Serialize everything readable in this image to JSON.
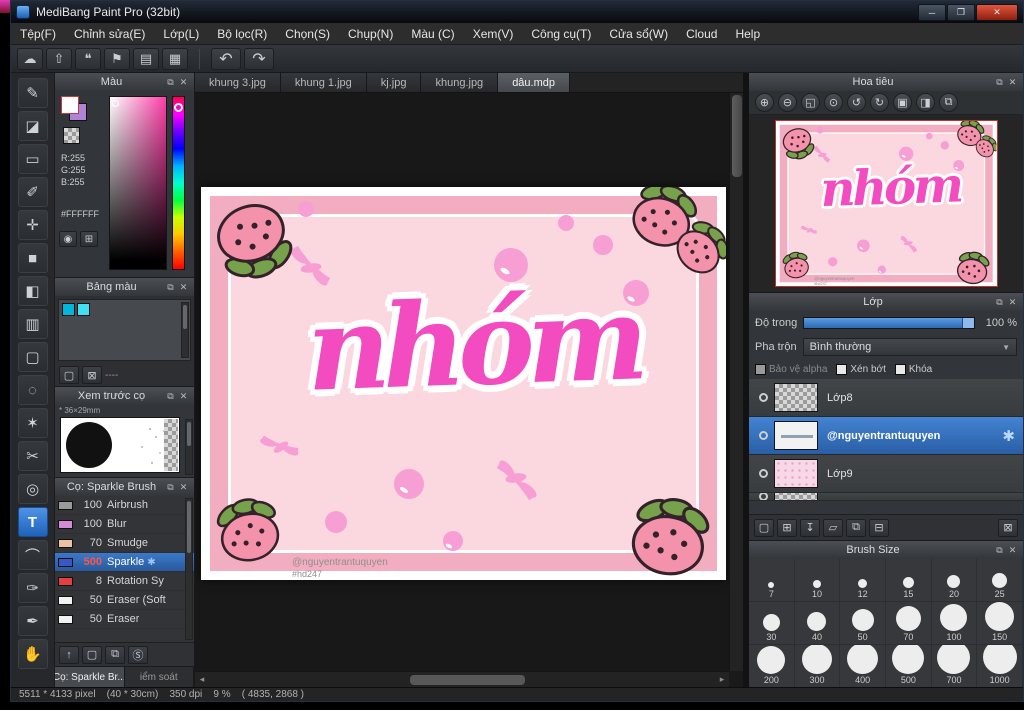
{
  "window": {
    "title": "MediBang Paint Pro (32bit)",
    "controls": {
      "minimize": "─",
      "maximize": "❐",
      "close": "✕"
    }
  },
  "menu": {
    "items": [
      "Tệp(F)",
      "Chỉnh sửa(E)",
      "Lớp(L)",
      "Bộ lọc(R)",
      "Chọn(S)",
      "Chụp(N)",
      "Màu (C)",
      "Xem(V)",
      "Công cụ(T)",
      "Cửa sổ(W)",
      "Cloud",
      "Help"
    ]
  },
  "toolbar": {
    "buttons": [
      {
        "name": "cloud",
        "glyph": "☁"
      },
      {
        "name": "upload",
        "glyph": "⇧"
      },
      {
        "name": "comment",
        "glyph": "❝"
      },
      {
        "name": "material",
        "glyph": "⚑"
      },
      {
        "name": "document",
        "glyph": "▤"
      },
      {
        "name": "layout-grid",
        "glyph": "▦"
      },
      {
        "name": "undo",
        "glyph": "↶"
      },
      {
        "name": "redo",
        "glyph": "↷"
      }
    ]
  },
  "tools": [
    {
      "name": "brush",
      "glyph": "✎"
    },
    {
      "name": "eraser",
      "glyph": "◪"
    },
    {
      "name": "rect-select",
      "glyph": "▭"
    },
    {
      "name": "marker",
      "glyph": "✐"
    },
    {
      "name": "move",
      "glyph": "✛"
    },
    {
      "name": "shape-fill",
      "glyph": "■"
    },
    {
      "name": "bucket",
      "glyph": "◧"
    },
    {
      "name": "gradient",
      "glyph": "▥"
    },
    {
      "name": "marquee",
      "glyph": "▢"
    },
    {
      "name": "ellipse-select",
      "glyph": "◌"
    },
    {
      "name": "magic-wand",
      "glyph": "✶"
    },
    {
      "name": "scissors",
      "glyph": "✂"
    },
    {
      "name": "divide",
      "glyph": "◎"
    },
    {
      "name": "text",
      "glyph": "T",
      "selected": true
    },
    {
      "name": "curve",
      "glyph": "⌒"
    },
    {
      "name": "eyedropper",
      "glyph": "✑"
    },
    {
      "name": "pen",
      "glyph": "✒"
    },
    {
      "name": "hand",
      "glyph": "✋"
    }
  ],
  "color_panel": {
    "title": "Màu",
    "r": "R:255",
    "g": "G:255",
    "b": "B:255",
    "hex": "#FFFFFF"
  },
  "palette_panel": {
    "title": "Bảng màu",
    "swatch1": "#00b6d9",
    "swatch2": "#41dff2",
    "dashes": "----"
  },
  "preview_panel": {
    "title": "Xem trước cọ",
    "size_label": "* 36×29mm"
  },
  "brush_panel": {
    "title": "Cọ: Sparkle Brush",
    "sparkle_icon": "✱",
    "brushes": [
      {
        "size": "100",
        "name": "Airbrush",
        "chip": "#9a9a9a"
      },
      {
        "size": "100",
        "name": "Blur",
        "chip": "#d58ad5"
      },
      {
        "size": "70",
        "name": "Smudge",
        "chip": "#eac3a4"
      },
      {
        "size": "500",
        "name": "Sparkle",
        "chip": "#3a57c8",
        "selected": true
      },
      {
        "size": "8",
        "name": "Rotation Sy",
        "chip": "#e04040"
      },
      {
        "size": "50",
        "name": "Eraser (Soft",
        "chip": "#f2f2f2"
      },
      {
        "size": "50",
        "name": "Eraser",
        "chip": "#f2f2f2"
      }
    ]
  },
  "brush_footer": {
    "buttons": [
      {
        "name": "upload-brush",
        "glyph": "↑"
      },
      {
        "name": "new-brush",
        "glyph": "▢"
      },
      {
        "name": "duplicate-brush",
        "glyph": "⧉"
      },
      {
        "name": "brush-script",
        "glyph": "Ⓢ"
      }
    ]
  },
  "bottom_tabs": [
    {
      "label": "Cọ: Sparkle Br..."
    },
    {
      "label": "iểm soát"
    }
  ],
  "doc_tabs": [
    {
      "label": "khung 3.jpg"
    },
    {
      "label": "khung 1.jpg"
    },
    {
      "label": "kj.jpg"
    },
    {
      "label": "khung.jpg"
    },
    {
      "label": "dâu.mdp",
      "active": true
    }
  ],
  "canvas": {
    "word": "nhóm",
    "credit1": "@nguyentrantuquyen",
    "credit2": "#hd247"
  },
  "navigator": {
    "title": "Hoa tiêu",
    "buttons": [
      {
        "name": "zoom-in",
        "glyph": "⊕"
      },
      {
        "name": "zoom-out",
        "glyph": "⊖"
      },
      {
        "name": "zoom-fit",
        "glyph": "◱"
      },
      {
        "name": "zoom-100",
        "glyph": "⊙"
      },
      {
        "name": "rotate-ccw",
        "glyph": "↺"
      },
      {
        "name": "rotate-cw",
        "glyph": "↻"
      },
      {
        "name": "select-area",
        "glyph": "▣"
      },
      {
        "name": "flip",
        "glyph": "◨"
      },
      {
        "name": "copy-view",
        "glyph": "⧉"
      }
    ]
  },
  "layer_panel": {
    "title": "Lớp",
    "opacity_label": "Độ trong",
    "opacity_value": "100 %",
    "blend_label": "Pha trộn",
    "blend_value": "Bình thường",
    "checkbox1": "Bảo vệ alpha",
    "checkbox2": "Xén bớt",
    "checkbox3": "Khóa",
    "layers": [
      {
        "name": "Lớp8"
      },
      {
        "name": "@nguyentrantuquyen",
        "selected": true,
        "badge": "✱"
      },
      {
        "name": "Lớp9"
      }
    ],
    "buttons": [
      {
        "name": "new-layer",
        "glyph": "▢"
      },
      {
        "name": "add-layer",
        "glyph": "⊞"
      },
      {
        "name": "layer-down",
        "glyph": "↧"
      },
      {
        "name": "new-folder",
        "glyph": "▱"
      },
      {
        "name": "duplicate-layer",
        "glyph": "⧉"
      },
      {
        "name": "merge-layer",
        "glyph": "⊟"
      },
      {
        "name": "delete-layer",
        "glyph": "⊠"
      }
    ]
  },
  "brush_size_panel": {
    "title": "Brush Size",
    "sizes": [
      "7",
      "10",
      "12",
      "15",
      "20",
      "25",
      "30",
      "40",
      "50",
      "70",
      "100",
      "150",
      "200",
      "300",
      "400",
      "500",
      "700",
      "1000"
    ]
  },
  "status_bar": {
    "text": "5511 * 4133 pixel    (40 * 30cm)    350 dpi    9 %    ( 4835, 2868 )"
  },
  "panel_icons": {
    "float": "⧉",
    "close": "✕"
  },
  "scroll": {
    "left": "◂",
    "right": "▸"
  }
}
